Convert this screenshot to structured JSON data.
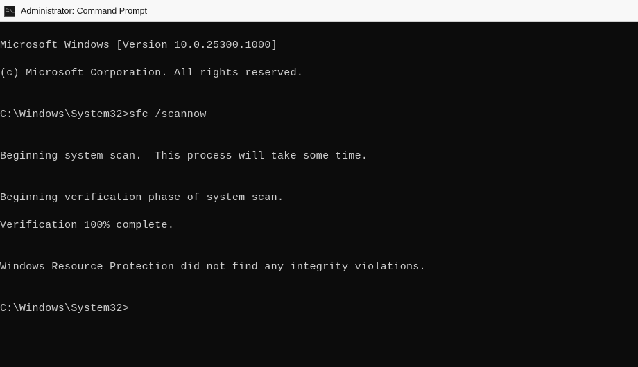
{
  "window": {
    "title": "Administrator: Command Prompt"
  },
  "terminal": {
    "lines": {
      "l0": "Microsoft Windows [Version 10.0.25300.1000]",
      "l1": "(c) Microsoft Corporation. All rights reserved.",
      "l2": "",
      "l3_prompt": "C:\\Windows\\System32>",
      "l3_cmd": "sfc /scannow",
      "l4": "",
      "l5": "Beginning system scan.  This process will take some time.",
      "l6": "",
      "l7": "Beginning verification phase of system scan.",
      "l8": "Verification 100% complete.",
      "l9": "",
      "l10": "Windows Resource Protection did not find any integrity violations.",
      "l11": "",
      "l12_prompt": "C:\\Windows\\System32>"
    }
  }
}
